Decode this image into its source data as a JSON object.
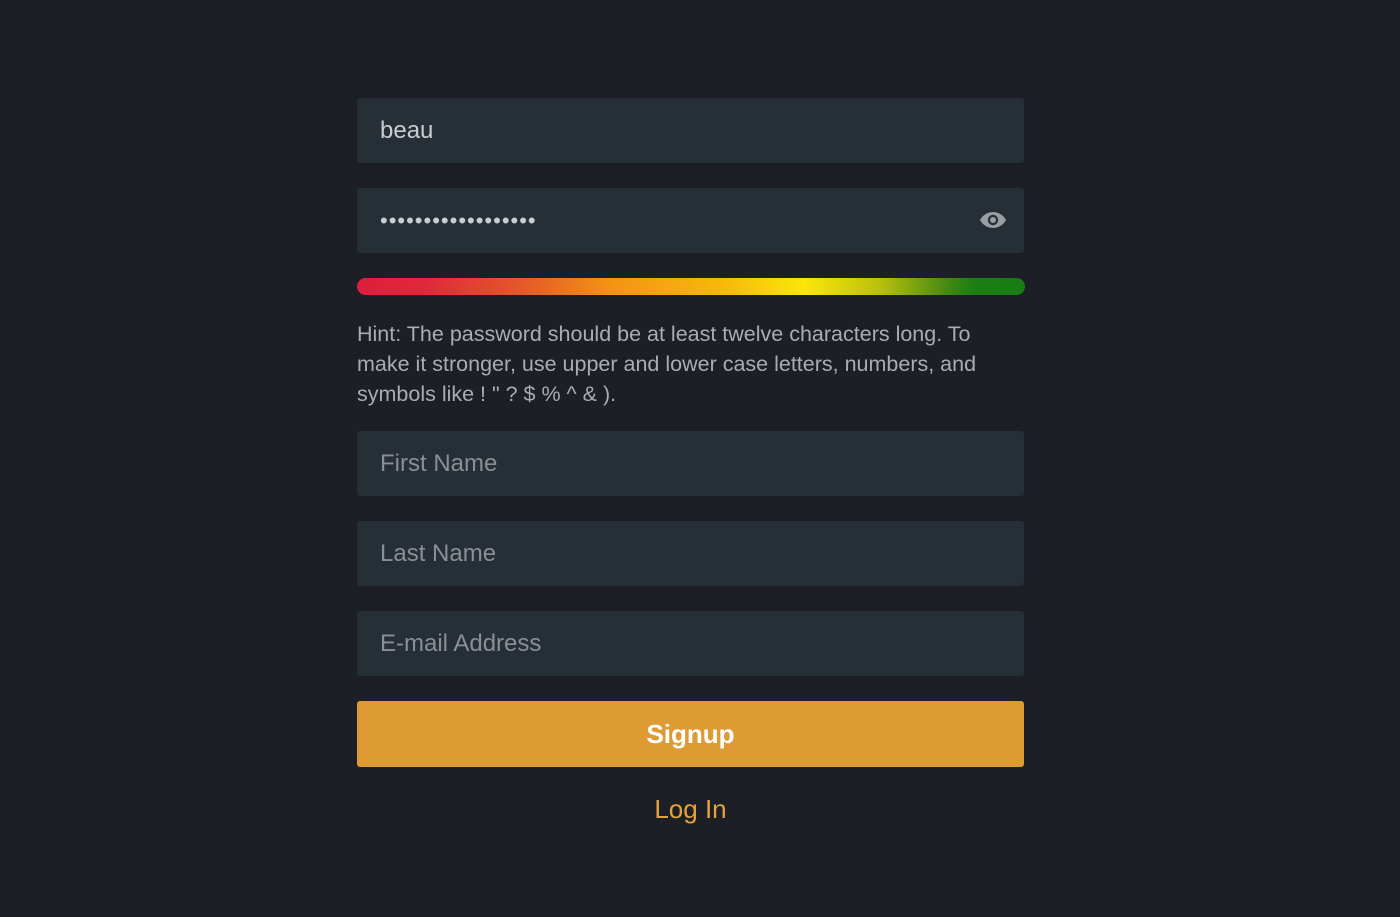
{
  "form": {
    "username": {
      "value": "beau",
      "placeholder": ""
    },
    "password": {
      "value": "••••••••••••••••••",
      "icon": "eye-icon"
    },
    "strength": {
      "level": 1.0,
      "colors": [
        "#dc1f3c",
        "#f39414",
        "#fbe60a",
        "#177d12"
      ]
    },
    "hint": "Hint: The password should be at least twelve characters long. To make it stronger, use upper and lower case letters, numbers, and symbols like ! \" ? $ % ^ & ).",
    "first_name": {
      "placeholder": "First Name"
    },
    "last_name": {
      "placeholder": "Last Name"
    },
    "email": {
      "placeholder": "E-mail Address"
    },
    "signup_label": "Signup",
    "login_label": "Log In"
  },
  "colors": {
    "background": "#1c1f26",
    "field": "#262e36",
    "accent": "#de9b34",
    "link": "#e4a23c"
  }
}
